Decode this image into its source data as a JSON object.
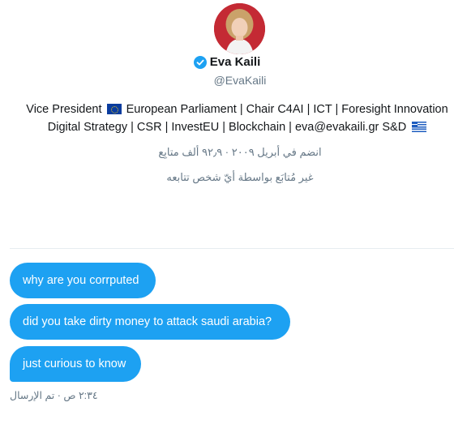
{
  "profile": {
    "name": "Eva Kaili",
    "handle": "@EvaKaili",
    "bio_line1_a": "Vice President",
    "bio_line1_b": "European Parliament | Chair C4AI | ICT | Foresight Innovation",
    "bio_line2": "Digital Strategy | CSR | InvestEU | Blockchain | eva@evakaili.gr S&D",
    "joined": "انضم في أبريل ٢٠٠٩ · ٩٢٫٩ ألف متابِع",
    "follows_status": "غير مُتابَع بواسطة أيّ شخص تتابعه"
  },
  "messages": [
    {
      "text": "why are you corrputed"
    },
    {
      "text": "did you take dirty money to attack saudi arabia?"
    },
    {
      "text": "just curious to know"
    }
  ],
  "sent_status": "٢:٣٤ ص · تم الإرسال",
  "colors": {
    "accent": "#1da1f2",
    "muted": "#657786",
    "text": "#14171a"
  },
  "icons": {
    "verified": "verified-badge-icon",
    "eu_flag": "eu-flag-icon",
    "greek_flag": "greece-flag-icon"
  }
}
